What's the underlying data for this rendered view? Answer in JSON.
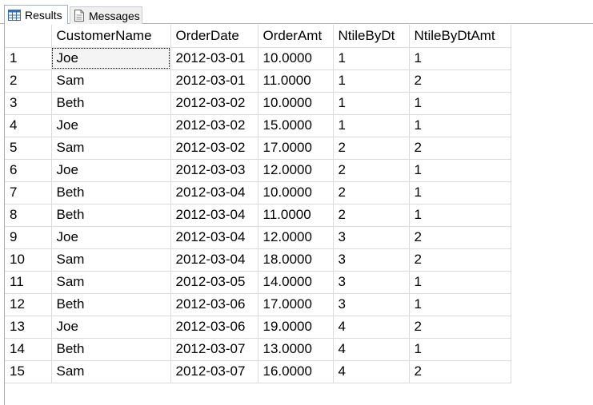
{
  "tabs": [
    {
      "label": "Results",
      "icon": "grid-icon",
      "active": true
    },
    {
      "label": "Messages",
      "icon": "document-icon",
      "active": false
    }
  ],
  "grid": {
    "columns": [
      "",
      "CustomerName",
      "OrderDate",
      "OrderAmt",
      "NtileByDt",
      "NtileByDtAmt"
    ],
    "rows": [
      [
        "1",
        "Joe",
        "2012-03-01",
        "10.0000",
        "1",
        "1"
      ],
      [
        "2",
        "Sam",
        "2012-03-01",
        "11.0000",
        "1",
        "2"
      ],
      [
        "3",
        "Beth",
        "2012-03-02",
        "10.0000",
        "1",
        "1"
      ],
      [
        "4",
        "Joe",
        "2012-03-02",
        "15.0000",
        "1",
        "1"
      ],
      [
        "5",
        "Sam",
        "2012-03-02",
        "17.0000",
        "2",
        "2"
      ],
      [
        "6",
        "Joe",
        "2012-03-03",
        "12.0000",
        "2",
        "1"
      ],
      [
        "7",
        "Beth",
        "2012-03-04",
        "10.0000",
        "2",
        "1"
      ],
      [
        "8",
        "Beth",
        "2012-03-04",
        "11.0000",
        "2",
        "1"
      ],
      [
        "9",
        "Joe",
        "2012-03-04",
        "12.0000",
        "3",
        "2"
      ],
      [
        "10",
        "Sam",
        "2012-03-04",
        "18.0000",
        "3",
        "2"
      ],
      [
        "11",
        "Sam",
        "2012-03-05",
        "14.0000",
        "3",
        "1"
      ],
      [
        "12",
        "Beth",
        "2012-03-06",
        "17.0000",
        "3",
        "1"
      ],
      [
        "13",
        "Joe",
        "2012-03-06",
        "19.0000",
        "4",
        "2"
      ],
      [
        "14",
        "Beth",
        "2012-03-07",
        "13.0000",
        "4",
        "1"
      ],
      [
        "15",
        "Sam",
        "2012-03-07",
        "16.0000",
        "4",
        "2"
      ]
    ]
  }
}
